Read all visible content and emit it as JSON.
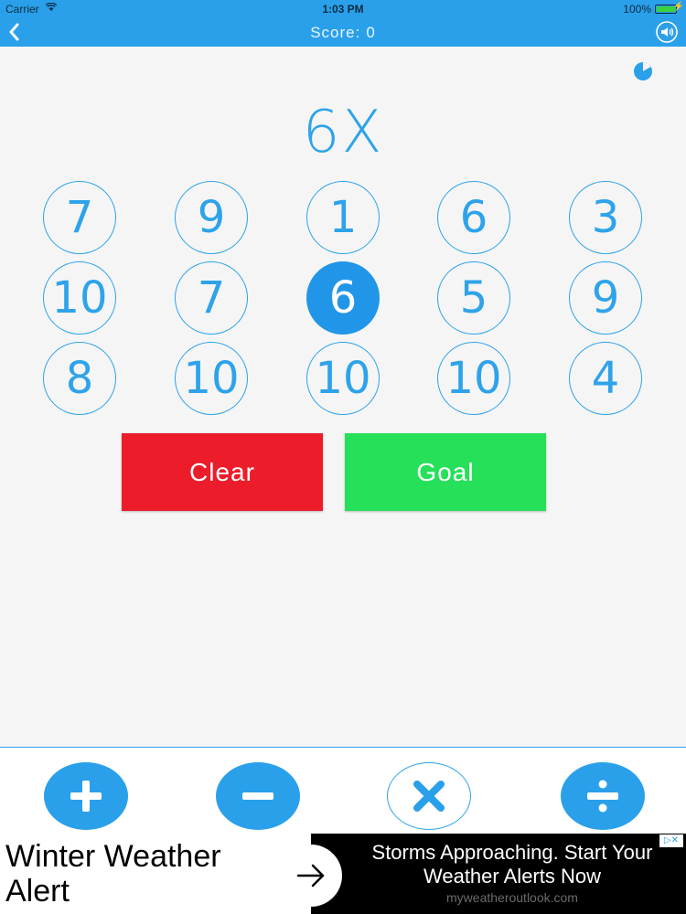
{
  "status_bar": {
    "carrier": "Carrier",
    "time": "1:03 PM",
    "battery": "100%"
  },
  "nav": {
    "score_label": "Score:",
    "score_value": "0",
    "back_icon": "chevron-left-icon",
    "sound_icon": "speaker-icon"
  },
  "game": {
    "target": "6X",
    "numbers": [
      "7",
      "9",
      "1",
      "6",
      "3",
      "10",
      "7",
      "6",
      "5",
      "9",
      "8",
      "10",
      "10",
      "10",
      "4"
    ],
    "selected_index": 7,
    "clear_label": "Clear",
    "goal_label": "Goal"
  },
  "operations": [
    "plus-icon",
    "minus-icon",
    "multiply-icon",
    "divide-icon"
  ],
  "ad": {
    "headline": "Winter Weather Alert",
    "body": "Storms Approaching. Start Your Weather Alerts Now",
    "domain": "myweatheroutlook.com"
  },
  "colors": {
    "accent": "#2aa0ea",
    "clear": "#ec1c2b",
    "goal": "#26e05a"
  }
}
